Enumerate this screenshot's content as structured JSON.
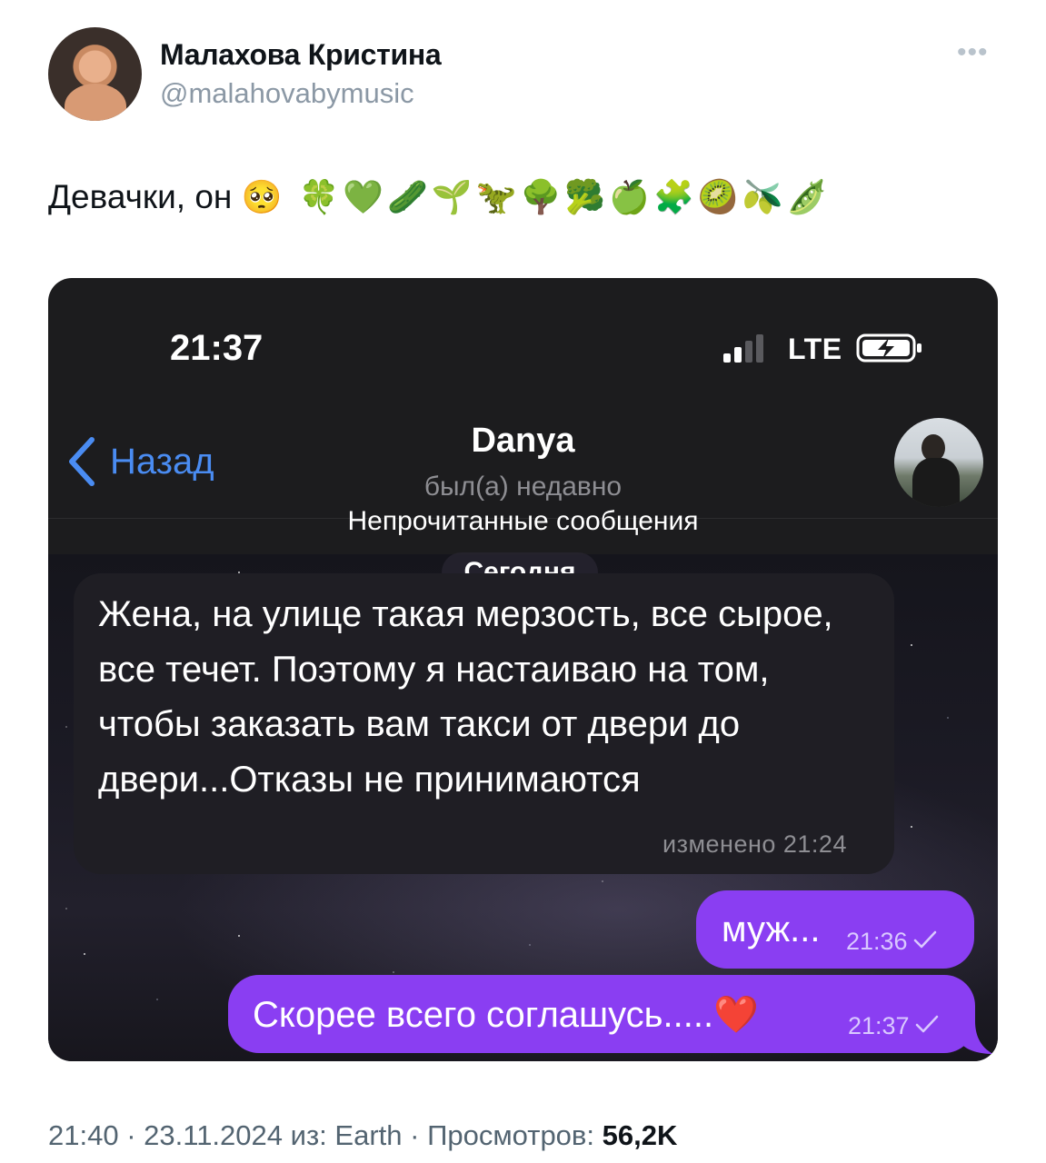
{
  "tweet": {
    "author_name": "Малахова Кристина",
    "author_handle": "@malahovabymusic",
    "text": "Девачки, он",
    "emojis": "🥺 🍀💚🥒🌱🦖🌳🥦🍏🧩🥝🫒🫛",
    "more_icon": "more-dots-icon",
    "meta": {
      "time": "21:40",
      "date": "23.11.2024",
      "source_label": "из:",
      "source": "Earth",
      "views_label": "Просмотров:",
      "views": "56,2K",
      "separator": "·"
    }
  },
  "screenshot": {
    "status_bar": {
      "time": "21:37",
      "network": "LTE",
      "battery_icon": "battery-charging-icon",
      "signal_icon": "signal-bars-icon"
    },
    "chat_header": {
      "back_label": "Назад",
      "name": "Danya",
      "status": "был(а) недавно"
    },
    "unread_label": "Непрочитанные сообщения",
    "date_label": "Сегодня",
    "messages": [
      {
        "direction": "incoming",
        "text": "Жена, на улице такая мерзость, все сырое, все течет. Поэтому я настаиваю на том, чтобы заказать вам такси от двери до двери...Отказы не принимаются",
        "meta": "изменено 21:24"
      },
      {
        "direction": "outgoing",
        "text": "муж...",
        "time": "21:36"
      },
      {
        "direction": "outgoing",
        "text": "Скорее всего соглашусь.....❤️",
        "time": "21:37"
      }
    ],
    "colors": {
      "accent_link": "#4a8cf2",
      "outgoing_bubble": "#8a3ef2",
      "incoming_bubble": "#1f1e24"
    }
  }
}
